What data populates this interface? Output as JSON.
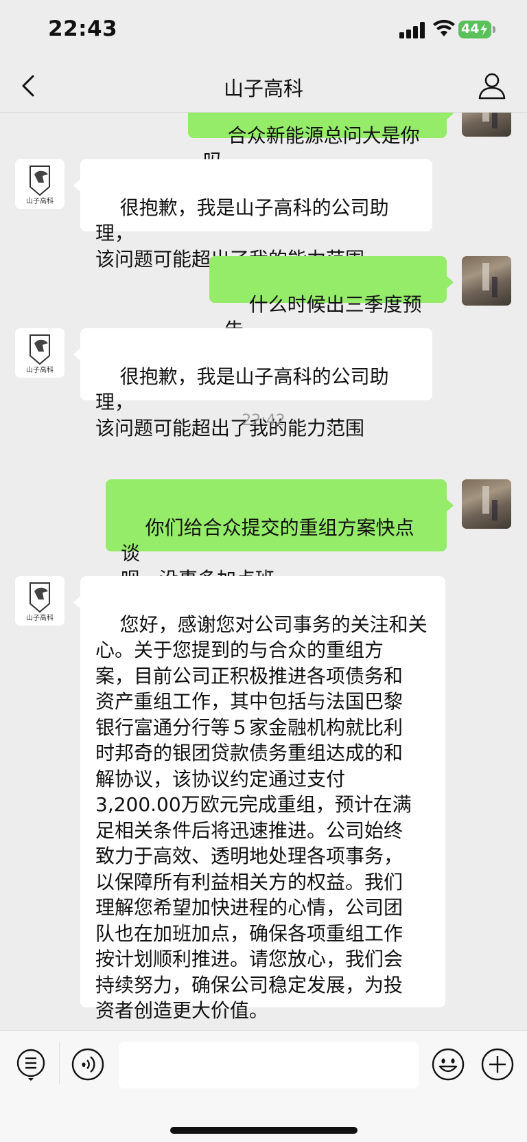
{
  "status_bar": {
    "time": "22:43",
    "battery": "44"
  },
  "header": {
    "title": "山子高科"
  },
  "messages": [
    {
      "side": "out",
      "text": "合众新能源总问大是你吗"
    },
    {
      "side": "in",
      "text": "很抱歉，我是山子高科的公司助理，\n该问题可能超出了我的能力范围"
    },
    {
      "side": "out",
      "text": "什么时候出三季度预告"
    },
    {
      "side": "in",
      "text": "很抱歉，我是山子高科的公司助理，\n该问题可能超出了我的能力范围"
    },
    {
      "side": "time",
      "text": "22:42"
    },
    {
      "side": "out",
      "text": "你们给合众提交的重组方案快点谈\n呗，没事多加点班"
    },
    {
      "side": "in",
      "text": "您好，感谢您对公司事务的关注和关\n心。关于您提到的与合众的重组方\n案，目前公司正积极推进各项债务和\n资产重组工作，其中包括与法国巴黎\n银行富通分行等５家金融机构就比利\n时邦奇的银团贷款债务重组达成的和\n解协议，该协议约定通过支付\n3,200.00万欧元完成重组，预计在满\n足相关条件后将迅速推进。公司始终\n致力于高效、透明地处理各项事务，\n以保障所有利益相关方的权益。我们\n理解您希望加快进程的心情，公司团\n队也在加班加点，确保各项重组工作\n按计划顺利推进。请您放心，我们会\n持续努力，确保公司稳定发展，为投\n资者创造更大价值。"
    }
  ],
  "bot_avatar": {
    "logo_text": "山子高科"
  },
  "colors": {
    "outgoing_bubble": "#95ec69",
    "incoming_bubble": "#ffffff",
    "background": "#ededed"
  }
}
